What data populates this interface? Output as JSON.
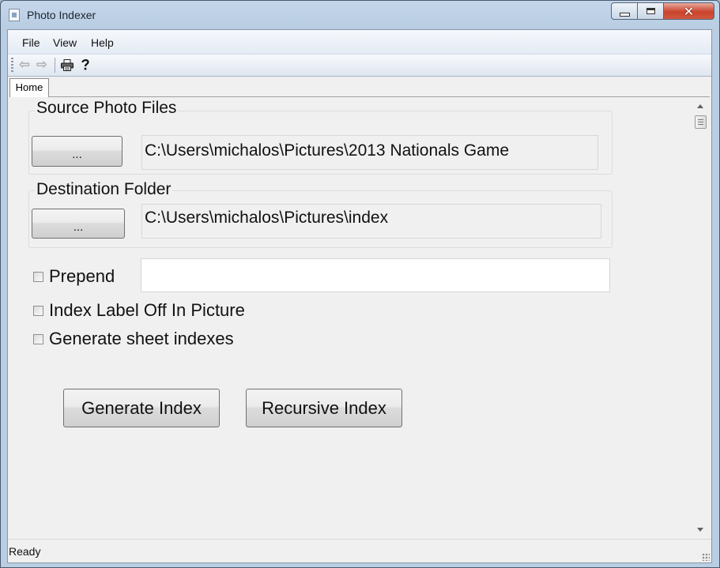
{
  "window": {
    "title": "Photo Indexer",
    "controls": {
      "minimize": "—",
      "maximize": "□",
      "close": "✕"
    }
  },
  "menu": [
    "File",
    "View",
    "Help"
  ],
  "toolbar": {
    "back_icon": "back-arrow-icon",
    "forward_icon": "forward-arrow-icon",
    "print_icon": "printer-icon",
    "help_icon": "help-question-icon"
  },
  "tabs": [
    {
      "label": "Home",
      "selected": true
    }
  ],
  "source": {
    "group_label": "Source Photo Files",
    "browse_label": "...",
    "path": "C:\\Users\\michalos\\Pictures\\2013 Nationals Game"
  },
  "destination": {
    "group_label": "Destination Folder",
    "browse_label": "...",
    "path": "C:\\Users\\michalos\\Pictures\\index"
  },
  "options": {
    "prepend": {
      "label": "Prepend",
      "checked": false,
      "value": ""
    },
    "index_label_off": {
      "label": "Index Label Off In Picture",
      "checked": false
    },
    "generate_sheets": {
      "label": "Generate sheet indexes",
      "checked": false
    }
  },
  "actions": {
    "generate": "Generate Index",
    "recursive": "Recursive Index"
  },
  "status": "Ready"
}
